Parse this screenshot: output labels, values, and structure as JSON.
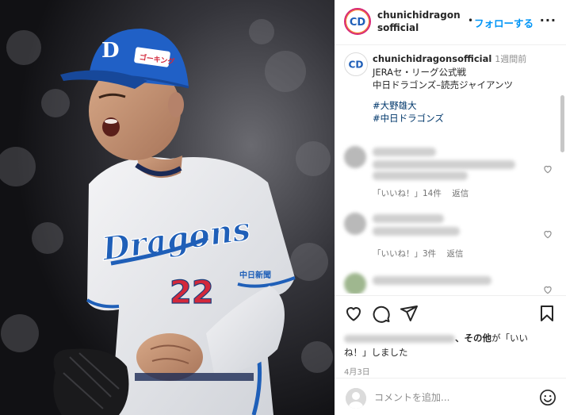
{
  "account": {
    "username": "chunichidragonsofficial",
    "avatar_text": "CD",
    "follow_label": "フォローする",
    "separator": "•",
    "more_label": "···"
  },
  "caption": {
    "username": "chunichidragonsofficial",
    "time": "1週間前",
    "lines": [
      "JERAセ・リーグ公式戦",
      "中日ドラゴンズ–読売ジャイアンツ"
    ],
    "hashtags": [
      "#大野雄大",
      "#中日ドラゴンズ"
    ]
  },
  "comments": [
    {
      "likes_label": "「いいね！」14件",
      "reply_label": "返信"
    },
    {
      "likes_label": "「いいね！」3件",
      "reply_label": "返信"
    }
  ],
  "actions": {
    "icons": [
      "heart-icon",
      "comment-icon",
      "share-icon",
      "bookmark-icon"
    ]
  },
  "likes": {
    "suffix_bold": "、その他",
    "suffix_mid": "が「いい",
    "suffix_line2": "ね！」しました"
  },
  "date": "4月3日",
  "add_comment": {
    "placeholder": "コメントを追加..."
  },
  "photo": {
    "jersey_text": "Dragons",
    "number": "22",
    "sponsor": "中日新聞",
    "cap_logo": "D",
    "helmet_ad": "ゴーキング"
  },
  "colors": {
    "accent": "#0095f6",
    "dragons_blue": "#1f5fb8",
    "number_red": "#d3283b",
    "text": "#262626",
    "muted": "#8e8e8e"
  }
}
